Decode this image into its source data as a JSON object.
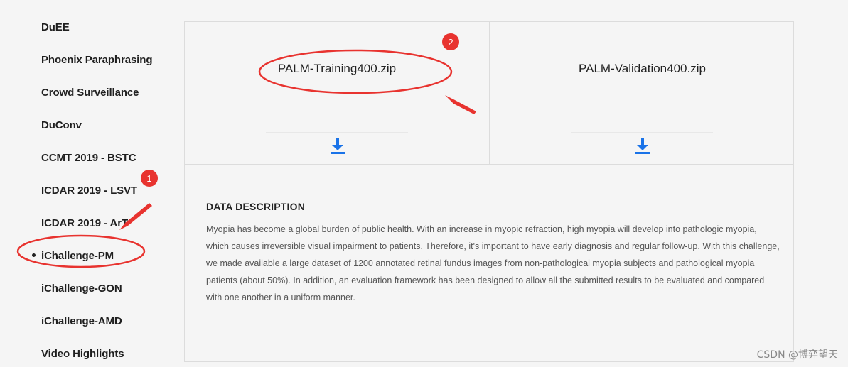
{
  "sidebar": {
    "items": [
      {
        "label": "DuEE"
      },
      {
        "label": "Phoenix Paraphrasing"
      },
      {
        "label": "Crowd Surveillance"
      },
      {
        "label": "DuConv"
      },
      {
        "label": "CCMT 2019 - BSTC"
      },
      {
        "label": "ICDAR 2019 - LSVT"
      },
      {
        "label": "ICDAR 2019 - ArT"
      },
      {
        "label": "iChallenge-PM",
        "active": true
      },
      {
        "label": "iChallenge-GON"
      },
      {
        "label": "iChallenge-AMD"
      },
      {
        "label": "Video Highlights"
      }
    ]
  },
  "files": [
    {
      "name": "PALM-Training400.zip",
      "icon": "download-icon"
    },
    {
      "name": "PALM-Validation400.zip",
      "icon": "download-icon"
    }
  ],
  "description": {
    "title": "DATA DESCRIPTION",
    "text": "Myopia has become a global burden of public health. With an increase in myopic refraction, high myopia will develop into pathologic myopia, which causes irreversible visual impairment to patients. Therefore, it's important to have early diagnosis and regular follow-up. With this challenge, we made available a large dataset of 1200 annotated retinal fundus images from non-pathological myopia subjects and pathological myopia patients (about 50%). In addition, an evaluation framework has been designed to allow all the submitted results to be evaluated and compared with one another in a uniform manner."
  },
  "annotations": {
    "badge1": "1",
    "badge2": "2",
    "color": "#e8332f"
  },
  "watermark": "CSDN @博弈望天",
  "colors": {
    "accent": "#1a73e8",
    "annotation": "#e8332f"
  }
}
